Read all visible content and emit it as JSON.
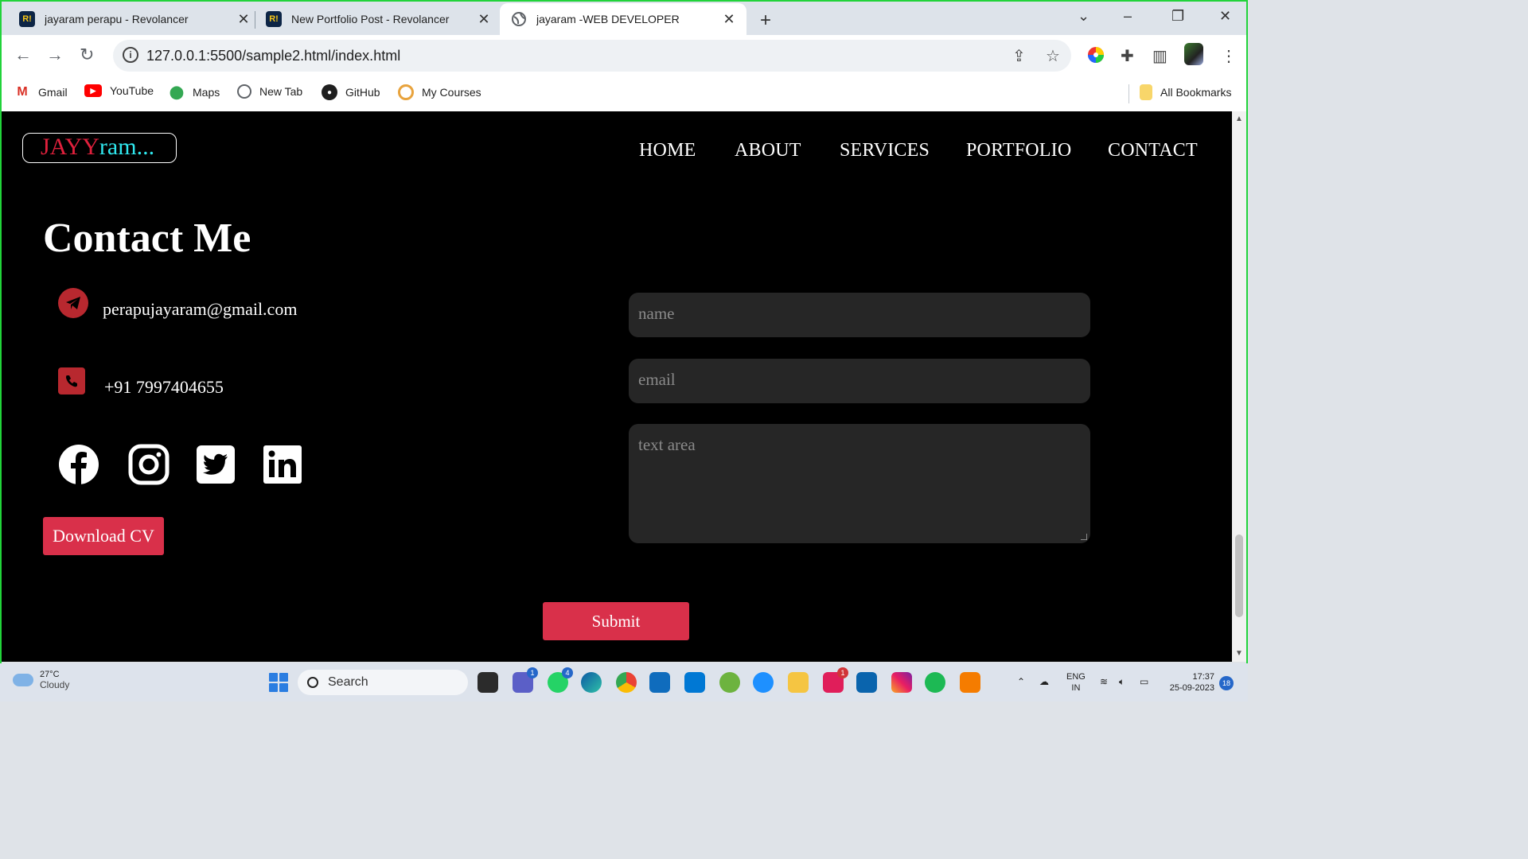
{
  "browser": {
    "tabs": [
      {
        "title": "jayaram perapu - Revolancer",
        "favicon": "R!"
      },
      {
        "title": "New Portfolio Post - Revolancer",
        "favicon": "R!"
      },
      {
        "title": "jayaram -WEB DEVELOPER",
        "favicon": "globe-icon"
      }
    ],
    "url": "127.0.0.1:5500/sample2.html/index.html",
    "bookmarks": [
      "Gmail",
      "YouTube",
      "Maps",
      "New Tab",
      "GitHub",
      "My Courses"
    ],
    "all_bookmarks": "All Bookmarks"
  },
  "site": {
    "logo": {
      "part1": "JAYY",
      "part2": "ram..."
    },
    "nav": [
      "HOME",
      "ABOUT",
      "SERVICES",
      "PORTFOLIO",
      "CONTACT"
    ],
    "contact": {
      "title": "Contact Me",
      "email": "perapujayaram@gmail.com",
      "phone": "+91 7997404655",
      "social": [
        "facebook-icon",
        "instagram-icon",
        "twitter-icon",
        "linkedin-icon"
      ],
      "download_cv": "Download CV"
    },
    "form": {
      "name_placeholder": "name",
      "email_placeholder": "email",
      "message_placeholder": "text area",
      "submit": "Submit"
    },
    "colors": {
      "accent": "#d9304a",
      "logo_red": "#e0203c",
      "logo_cyan": "#2fe7ee"
    }
  },
  "taskbar": {
    "weather": {
      "temp": "27°C",
      "condition": "Cloudy"
    },
    "search": "Search",
    "lang": {
      "line1": "ENG",
      "line2": "IN"
    },
    "time": "17:37",
    "date": "25-09-2023",
    "notifications": "18",
    "badges": {
      "teams": "1",
      "whatsapp": "4",
      "slack": "1"
    }
  }
}
